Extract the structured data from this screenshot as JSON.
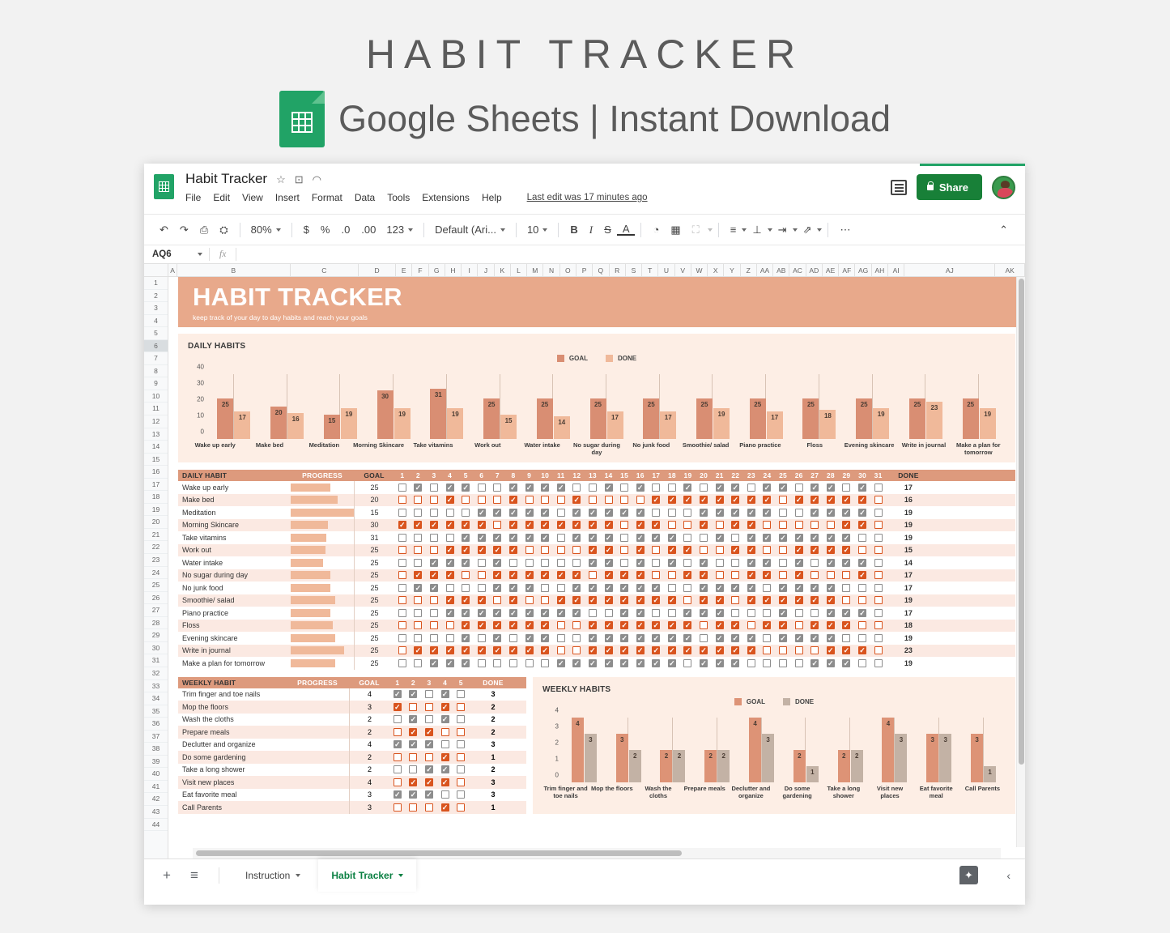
{
  "promo": {
    "title": "HABIT TRACKER",
    "subtitle": "Google Sheets | Instant Download"
  },
  "app": {
    "doc_title": "Habit Tracker",
    "menus": [
      "File",
      "Edit",
      "View",
      "Insert",
      "Format",
      "Data",
      "Tools",
      "Extensions",
      "Help"
    ],
    "last_edit": "Last edit was 17 minutes ago",
    "share_label": "Share",
    "zoom": "80%",
    "font": "Default (Ari...",
    "font_size": "10",
    "number_format": "123",
    "name_box": "AQ6",
    "formula_value": ""
  },
  "columns": [
    "A",
    "B",
    "C",
    "D",
    "E",
    "F",
    "G",
    "H",
    "I",
    "J",
    "K",
    "L",
    "M",
    "N",
    "O",
    "P",
    "Q",
    "R",
    "S",
    "T",
    "U",
    "V",
    "W",
    "X",
    "Y",
    "Z",
    "AA",
    "AB",
    "AC",
    "AD",
    "AE",
    "AF",
    "AG",
    "AH",
    "AI",
    "AJ",
    "AK"
  ],
  "rows": [
    1,
    2,
    3,
    4,
    5,
    6,
    7,
    8,
    9,
    10,
    11,
    12,
    13,
    14,
    15,
    16,
    17,
    18,
    19,
    20,
    21,
    22,
    23,
    24,
    25,
    26,
    27,
    28,
    29,
    30,
    31,
    32,
    33,
    34,
    35,
    36,
    37,
    38,
    39,
    40,
    41,
    42,
    43,
    44
  ],
  "selected_row": 6,
  "banner": {
    "title": "HABIT TRACKER",
    "subtitle": "keep track of your day to day habits and reach your goals"
  },
  "colors": {
    "banner": "#e8a98b",
    "goal_bar": "#d98e73",
    "done_bar": "#f0b99a",
    "weekly_done_bar": "#c3b2a5",
    "card_bg": "#fdeee5",
    "header_bg": "#dd9a7d",
    "check_gray": "#8d8d8d",
    "check_orange": "#d9541e",
    "brand_green": "#188038"
  },
  "daily_card": {
    "title": "DAILY HABITS",
    "legend": [
      "GOAL",
      "DONE"
    ]
  },
  "weekly_card": {
    "title": "WEEKLY HABITS",
    "legend": [
      "GOAL",
      "DONE"
    ]
  },
  "daily_table": {
    "headers": {
      "habit": "DAILY HABIT",
      "progress": "PROGRESS",
      "goal": "GOAL",
      "done": "DONE"
    },
    "days": [
      1,
      2,
      3,
      4,
      5,
      6,
      7,
      8,
      9,
      10,
      11,
      12,
      13,
      14,
      15,
      16,
      17,
      18,
      19,
      20,
      21,
      22,
      23,
      24,
      25,
      26,
      27,
      28,
      29,
      30,
      31
    ],
    "rows": [
      {
        "habit": "Wake up early",
        "goal": 25,
        "done": 17,
        "style": "gray",
        "checks": [
          0,
          1,
          0,
          1,
          1,
          0,
          0,
          1,
          1,
          1,
          1,
          0,
          0,
          1,
          0,
          1,
          0,
          0,
          1,
          0,
          1,
          1,
          0,
          1,
          1,
          0,
          1,
          1,
          0,
          1,
          0
        ]
      },
      {
        "habit": "Make bed",
        "goal": 20,
        "done": 16,
        "style": "orange",
        "checks": [
          0,
          0,
          0,
          1,
          0,
          0,
          0,
          1,
          0,
          0,
          0,
          1,
          0,
          0,
          0,
          0,
          1,
          1,
          1,
          1,
          1,
          1,
          1,
          1,
          0,
          1,
          1,
          1,
          1,
          1,
          0
        ]
      },
      {
        "habit": "Meditation",
        "goal": 15,
        "done": 19,
        "style": "gray",
        "checks": [
          0,
          0,
          0,
          0,
          0,
          1,
          1,
          1,
          1,
          1,
          0,
          1,
          1,
          1,
          1,
          1,
          0,
          0,
          0,
          1,
          1,
          1,
          1,
          1,
          0,
          0,
          1,
          1,
          1,
          1,
          0
        ]
      },
      {
        "habit": "Morning Skincare",
        "goal": 30,
        "done": 19,
        "style": "orange",
        "checks": [
          1,
          1,
          1,
          1,
          1,
          1,
          0,
          1,
          1,
          1,
          1,
          1,
          1,
          1,
          0,
          1,
          1,
          0,
          0,
          1,
          0,
          1,
          1,
          0,
          0,
          0,
          0,
          0,
          1,
          1,
          0
        ]
      },
      {
        "habit": "Take vitamins",
        "goal": 31,
        "done": 19,
        "style": "gray",
        "checks": [
          0,
          0,
          0,
          0,
          1,
          1,
          1,
          1,
          1,
          1,
          0,
          1,
          1,
          1,
          0,
          1,
          1,
          1,
          0,
          0,
          1,
          0,
          1,
          1,
          1,
          1,
          1,
          1,
          1,
          0,
          0
        ]
      },
      {
        "habit": "Work out",
        "goal": 25,
        "done": 15,
        "style": "orange",
        "checks": [
          0,
          0,
          0,
          1,
          1,
          1,
          1,
          1,
          0,
          0,
          0,
          0,
          1,
          1,
          0,
          1,
          0,
          1,
          1,
          0,
          0,
          1,
          1,
          0,
          0,
          1,
          1,
          1,
          1,
          0,
          0
        ]
      },
      {
        "habit": "Water intake",
        "goal": 25,
        "done": 14,
        "style": "gray",
        "checks": [
          0,
          0,
          1,
          1,
          1,
          0,
          1,
          0,
          0,
          0,
          0,
          0,
          1,
          1,
          0,
          1,
          0,
          1,
          0,
          1,
          0,
          0,
          1,
          1,
          0,
          1,
          0,
          1,
          1,
          1,
          0
        ]
      },
      {
        "habit": "No sugar during day",
        "goal": 25,
        "done": 17,
        "style": "orange",
        "checks": [
          0,
          1,
          1,
          1,
          0,
          0,
          1,
          1,
          1,
          1,
          1,
          1,
          0,
          1,
          1,
          1,
          0,
          0,
          1,
          1,
          0,
          0,
          1,
          1,
          0,
          1,
          0,
          0,
          0,
          1,
          0
        ]
      },
      {
        "habit": "No junk food",
        "goal": 25,
        "done": 17,
        "style": "gray",
        "checks": [
          0,
          1,
          1,
          0,
          0,
          0,
          1,
          1,
          1,
          0,
          0,
          1,
          1,
          1,
          1,
          1,
          1,
          0,
          0,
          1,
          1,
          1,
          1,
          0,
          1,
          1,
          1,
          1,
          0,
          0,
          0
        ]
      },
      {
        "habit": "Smoothie/ salad",
        "goal": 25,
        "done": 19,
        "style": "orange",
        "checks": [
          0,
          0,
          0,
          1,
          1,
          1,
          0,
          1,
          0,
          0,
          1,
          1,
          1,
          1,
          1,
          1,
          1,
          1,
          0,
          1,
          1,
          0,
          1,
          1,
          1,
          1,
          1,
          1,
          0,
          0,
          0
        ]
      },
      {
        "habit": "Piano practice",
        "goal": 25,
        "done": 17,
        "style": "gray",
        "checks": [
          0,
          0,
          0,
          1,
          1,
          1,
          1,
          1,
          1,
          1,
          1,
          1,
          0,
          0,
          1,
          1,
          0,
          0,
          1,
          1,
          1,
          0,
          0,
          0,
          1,
          0,
          0,
          1,
          1,
          1,
          0
        ]
      },
      {
        "habit": "Floss",
        "goal": 25,
        "done": 18,
        "style": "orange",
        "checks": [
          0,
          0,
          0,
          0,
          1,
          1,
          1,
          1,
          1,
          1,
          0,
          0,
          1,
          1,
          1,
          1,
          1,
          1,
          1,
          0,
          1,
          1,
          0,
          1,
          1,
          0,
          1,
          1,
          1,
          0,
          0
        ]
      },
      {
        "habit": "Evening skincare",
        "goal": 25,
        "done": 19,
        "style": "gray",
        "checks": [
          0,
          0,
          0,
          0,
          1,
          0,
          1,
          0,
          1,
          1,
          0,
          0,
          1,
          1,
          1,
          1,
          1,
          1,
          1,
          0,
          1,
          1,
          1,
          0,
          1,
          1,
          1,
          1,
          0,
          0,
          0
        ]
      },
      {
        "habit": "Write in journal",
        "goal": 25,
        "done": 23,
        "style": "orange",
        "checks": [
          0,
          1,
          1,
          1,
          1,
          1,
          1,
          1,
          1,
          1,
          0,
          0,
          1,
          1,
          1,
          1,
          1,
          1,
          1,
          1,
          1,
          1,
          1,
          0,
          0,
          0,
          0,
          1,
          1,
          1,
          0
        ]
      },
      {
        "habit": "Make a plan for tomorrow",
        "goal": 25,
        "done": 19,
        "style": "gray",
        "checks": [
          0,
          0,
          1,
          1,
          1,
          0,
          0,
          0,
          0,
          0,
          1,
          1,
          1,
          1,
          1,
          1,
          1,
          1,
          0,
          1,
          1,
          1,
          0,
          0,
          0,
          0,
          1,
          1,
          1,
          0,
          0
        ]
      }
    ]
  },
  "weekly_table": {
    "headers": {
      "habit": "WEEKLY HABIT",
      "progress": "PROGRESS",
      "goal": "GOAL",
      "done": "DONE"
    },
    "days": [
      1,
      2,
      3,
      4,
      5
    ],
    "rows": [
      {
        "habit": "Trim finger and toe nails",
        "goal": 4,
        "done": 3,
        "style": "gray",
        "checks": [
          1,
          1,
          0,
          1,
          0
        ]
      },
      {
        "habit": "Mop the floors",
        "goal": 3,
        "done": 2,
        "style": "orange",
        "checks": [
          1,
          0,
          0,
          1,
          0
        ]
      },
      {
        "habit": "Wash the cloths",
        "goal": 2,
        "done": 2,
        "style": "gray",
        "checks": [
          0,
          1,
          0,
          1,
          0
        ]
      },
      {
        "habit": "Prepare meals",
        "goal": 2,
        "done": 2,
        "style": "orange",
        "checks": [
          0,
          1,
          1,
          0,
          0
        ]
      },
      {
        "habit": "Declutter and organize",
        "goal": 4,
        "done": 3,
        "style": "gray",
        "checks": [
          1,
          1,
          1,
          0,
          0
        ]
      },
      {
        "habit": "Do some gardening",
        "goal": 2,
        "done": 1,
        "style": "orange",
        "checks": [
          0,
          0,
          0,
          1,
          0
        ]
      },
      {
        "habit": "Take a long shower",
        "goal": 2,
        "done": 2,
        "style": "gray",
        "checks": [
          0,
          0,
          1,
          1,
          0
        ]
      },
      {
        "habit": "Visit new places",
        "goal": 4,
        "done": 3,
        "style": "orange",
        "checks": [
          0,
          1,
          1,
          1,
          0
        ]
      },
      {
        "habit": "Eat favorite meal",
        "goal": 3,
        "done": 3,
        "style": "gray",
        "checks": [
          1,
          1,
          1,
          0,
          0
        ]
      },
      {
        "habit": "Call Parents",
        "goal": 3,
        "done": 1,
        "style": "orange",
        "checks": [
          0,
          0,
          0,
          1,
          0
        ]
      }
    ]
  },
  "chart_data": [
    {
      "type": "bar",
      "title": "DAILY HABITS",
      "categories": [
        "Wake up early",
        "Make bed",
        "Meditation",
        "Morning Skincare",
        "Take vitamins",
        "Work out",
        "Water intake",
        "No sugar during day",
        "No junk food",
        "Smoothie/ salad",
        "Piano practice",
        "Floss",
        "Evening skincare",
        "Write in journal",
        "Make a plan for tomorrow"
      ],
      "series": [
        {
          "name": "GOAL",
          "values": [
            25,
            20,
            15,
            30,
            31,
            25,
            25,
            25,
            25,
            25,
            25,
            25,
            25,
            25,
            25
          ],
          "color": "#d98e73"
        },
        {
          "name": "DONE",
          "values": [
            17,
            16,
            19,
            19,
            19,
            15,
            14,
            17,
            17,
            19,
            17,
            18,
            19,
            23,
            19
          ],
          "color": "#f0b99a"
        }
      ],
      "ylabel": "",
      "xlabel": "",
      "yticks": [
        0,
        10,
        20,
        30,
        40
      ],
      "ylim": [
        0,
        40
      ],
      "grid": false,
      "legend": "top"
    },
    {
      "type": "bar",
      "title": "WEEKLY HABITS",
      "categories": [
        "Trim finger and toe nails",
        "Mop the floors",
        "Wash the cloths",
        "Prepare meals",
        "Declutter and organize",
        "Do some gardening",
        "Take a long shower",
        "Visit new places",
        "Eat favorite meal",
        "Call Parents"
      ],
      "series": [
        {
          "name": "GOAL",
          "values": [
            4,
            3,
            2,
            2,
            4,
            2,
            2,
            4,
            3,
            3
          ],
          "color": "#dd9376"
        },
        {
          "name": "DONE",
          "values": [
            3,
            2,
            2,
            2,
            3,
            1,
            2,
            3,
            3,
            1
          ],
          "color": "#c3b2a5"
        }
      ],
      "ylabel": "",
      "xlabel": "",
      "yticks": [
        0,
        1,
        2,
        3,
        4
      ],
      "ylim": [
        0,
        4
      ],
      "grid": false,
      "legend": "top"
    }
  ],
  "sheet_tabs": [
    {
      "label": "Instruction",
      "active": false
    },
    {
      "label": "Habit Tracker",
      "active": true
    }
  ],
  "bottom": {
    "add_sheet": "+",
    "all_sheets": "≡",
    "explore": "✦",
    "collapse": "‹"
  }
}
